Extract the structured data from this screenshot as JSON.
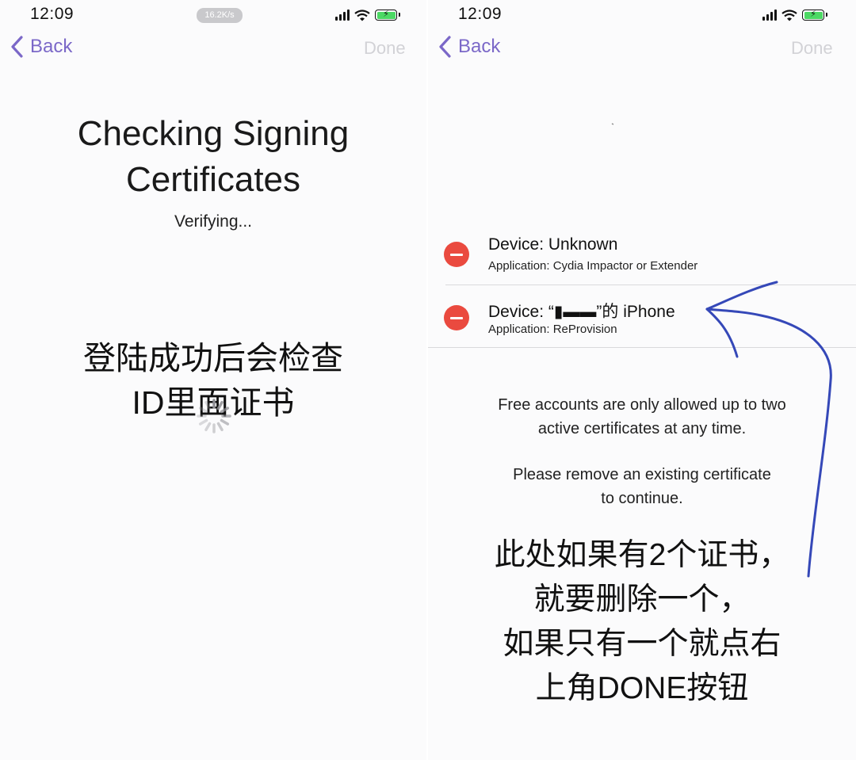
{
  "left_screen": {
    "status_bar": {
      "time": "12:09",
      "network_speed": "16.2K/s",
      "battery_level": 1.0
    },
    "nav": {
      "back_label": "Back",
      "done_label": "Done"
    },
    "title": "Checking Signing Certificates",
    "status_text": "Verifying...",
    "annotation_lines": [
      "登陆成功后会检查",
      "ID里面证书"
    ]
  },
  "right_screen": {
    "status_bar": {
      "time": "12:09",
      "battery_level": 1.0
    },
    "nav": {
      "back_label": "Back",
      "done_label": "Done"
    },
    "certificates": [
      {
        "device": "Device: Unknown",
        "application": "Application: Cydia Impactor or Extender"
      },
      {
        "device": "Device: “▮▬▬”的 iPhone",
        "application": "Application: ReProvision"
      }
    ],
    "info_text_1": [
      "Free accounts are only allowed up to two",
      "active certificates at any time."
    ],
    "info_text_2": [
      "Please remove an existing certificate",
      "to continue."
    ],
    "annotation_lines": [
      "此处如果有2个证书，",
      "就要删除一个，",
      "如果只有一个就点右",
      "上角DONE按钮"
    ]
  },
  "colors": {
    "accent": "#7b68c8",
    "done_disabled": "#d2d2d6",
    "delete_red": "#ea4a3f",
    "pen_blue": "#3548b8",
    "battery_green": "#4cd964"
  },
  "icons": [
    "chevron-left-icon",
    "signal-icon",
    "wifi-icon",
    "battery-icon",
    "delete-icon",
    "spinner-icon"
  ]
}
